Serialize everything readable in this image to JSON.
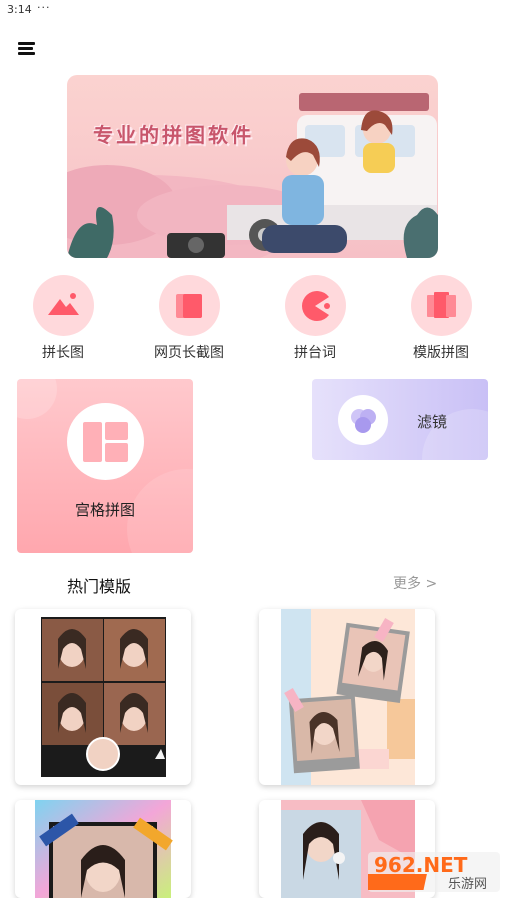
{
  "status_bar": {
    "time": "3:14",
    "dots": "···"
  },
  "banner": {
    "headline": "专业的拼图软件"
  },
  "functions": [
    {
      "label": "拼长图"
    },
    {
      "label": "网页长截图"
    },
    {
      "label": "拼台词"
    },
    {
      "label": "模版拼图"
    }
  ],
  "cards": {
    "grid": {
      "label": "宫格拼图"
    },
    "filter": {
      "label": "滤镜"
    }
  },
  "hot_templates": {
    "title": "热门模版",
    "more": "更多 >"
  },
  "watermark": {
    "text_top": "962.NET",
    "text_bottom": "乐游网"
  },
  "colors": {
    "accent_pink": "#ff5a6a",
    "icon_bg": "#ffd9dc",
    "filter_accent": "#b8a8f0"
  }
}
